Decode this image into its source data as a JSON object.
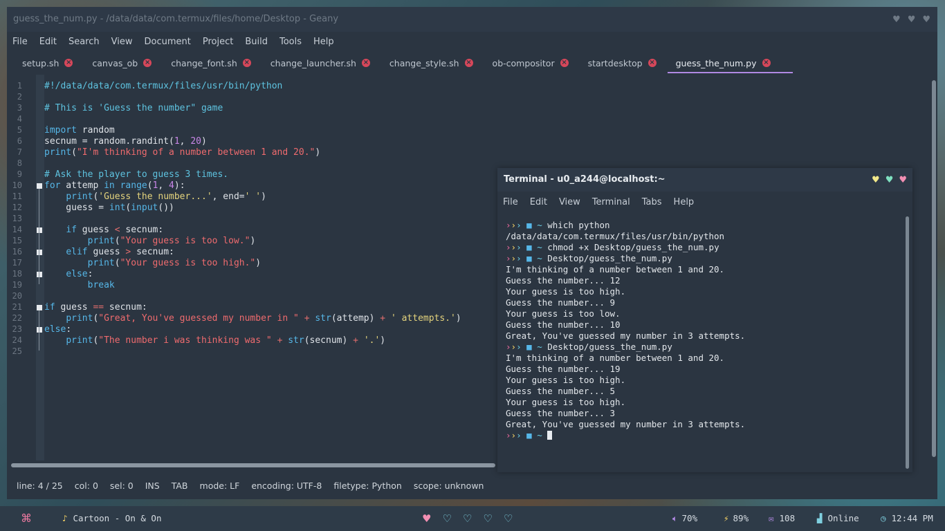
{
  "geany": {
    "title": "guess_the_num.py - /data/data/com.termux/files/home/Desktop - Geany",
    "menu": [
      "File",
      "Edit",
      "Search",
      "View",
      "Document",
      "Project",
      "Build",
      "Tools",
      "Help"
    ],
    "tabs": [
      "setup.sh",
      "canvas_ob",
      "change_font.sh",
      "change_launcher.sh",
      "change_style.sh",
      "ob-compositor",
      "startdesktop",
      "guess_the_num.py"
    ],
    "active_tab": "guess_the_num.py",
    "status": {
      "line": "line: 4 / 25",
      "col": "col: 0",
      "sel": "sel: 0",
      "ins": "INS",
      "tab": "TAB",
      "mode": "mode: LF",
      "encoding": "encoding: UTF-8",
      "filetype": "filetype: Python",
      "scope": "scope: unknown"
    }
  },
  "code_lines": [
    "#!/data/data/com.termux/files/usr/bin/python",
    "",
    "# This is 'Guess the number\" game",
    "",
    "import random",
    "secnum = random.randint(1, 20)",
    "print(\"I'm thinking of a number between 1 and 20.\")",
    "",
    "# Ask the player to guess 3 times.",
    "for attemp in range(1, 4):",
    "    print('Guess the number...', end=' ')",
    "    guess = int(input())",
    "",
    "    if guess < secnum:",
    "        print(\"Your guess is too low.\")",
    "    elif guess > secnum:",
    "        print(\"Your guess is too high.\")",
    "    else:",
    "        break",
    "",
    "if guess == secnum:",
    "    print(\"Great, You've guessed my number in \" + str(attemp) + ' attempts.')",
    "else:",
    "    print(\"The number i was thinking was \" + str(secnum) + '.')",
    ""
  ],
  "terminal": {
    "title": "Terminal - u0_a244@localhost:~",
    "menu": [
      "File",
      "Edit",
      "View",
      "Terminal",
      "Tabs",
      "Help"
    ],
    "prompt": {
      "marks": "›››",
      "home": "~"
    },
    "lines": [
      {
        "type": "cmd",
        "text": "which python"
      },
      {
        "type": "out",
        "text": "/data/data/com.termux/files/usr/bin/python"
      },
      {
        "type": "cmd",
        "text": "chmod +x Desktop/guess_the_num.py"
      },
      {
        "type": "cmd",
        "text": "Desktop/guess_the_num.py"
      },
      {
        "type": "out",
        "text": "I'm thinking of a number between 1 and 20."
      },
      {
        "type": "out",
        "text": "Guess the number... 12"
      },
      {
        "type": "out",
        "text": "Your guess is too high."
      },
      {
        "type": "out",
        "text": "Guess the number... 9"
      },
      {
        "type": "out",
        "text": "Your guess is too low."
      },
      {
        "type": "out",
        "text": "Guess the number... 10"
      },
      {
        "type": "out",
        "text": "Great, You've guessed my number in 3 attempts."
      },
      {
        "type": "cmd",
        "text": "Desktop/guess_the_num.py"
      },
      {
        "type": "out",
        "text": "I'm thinking of a number between 1 and 20."
      },
      {
        "type": "out",
        "text": "Guess the number... 19"
      },
      {
        "type": "out",
        "text": "Your guess is too high."
      },
      {
        "type": "out",
        "text": "Guess the number... 5"
      },
      {
        "type": "out",
        "text": "Your guess is too high."
      },
      {
        "type": "out",
        "text": "Guess the number... 3"
      },
      {
        "type": "out",
        "text": "Great, You've guessed my number in 3 attempts."
      },
      {
        "type": "cmd",
        "text": ""
      }
    ]
  },
  "taskbar": {
    "launcher_icon": "command-icon",
    "music": "Cartoon - On & On",
    "workspaces": [
      "heart-filled",
      "heart-outline",
      "heart-outline",
      "heart-outline",
      "heart-outline"
    ],
    "volume": "70%",
    "battery": "89%",
    "mail": "108",
    "network": "Online",
    "clock": "12:44 PM"
  },
  "colors": {
    "heart_yellow": "#f3e98a",
    "heart_green": "#7fe0c0",
    "heart_pink": "#f38fb3",
    "accent": "#b189e3",
    "workspace_active": "#f38fb3"
  }
}
